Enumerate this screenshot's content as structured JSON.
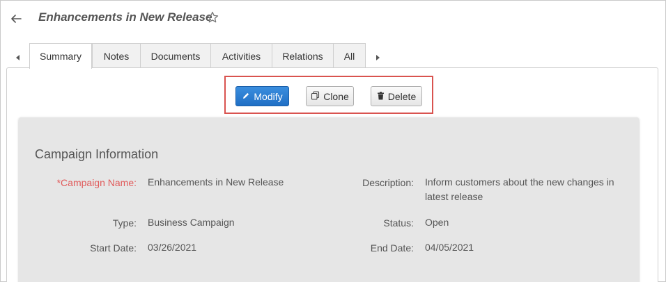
{
  "header": {
    "title": "Enhancements in New Release"
  },
  "tabs": [
    {
      "label": "Summary",
      "active": true
    },
    {
      "label": "Notes",
      "active": false
    },
    {
      "label": "Documents",
      "active": false
    },
    {
      "label": "Activities",
      "active": false
    },
    {
      "label": "Relations",
      "active": false
    },
    {
      "label": "All",
      "active": false
    }
  ],
  "toolbar": {
    "modify_label": "Modify",
    "clone_label": "Clone",
    "delete_label": "Delete"
  },
  "section": {
    "title": "Campaign Information",
    "fields": {
      "campaign_name": {
        "label": "*Campaign Name:",
        "value": "Enhancements in New Release",
        "required": true
      },
      "description": {
        "label": "Description:",
        "value": "Inform customers about the new changes in latest release"
      },
      "type": {
        "label": "Type:",
        "value": "Business Campaign"
      },
      "status": {
        "label": "Status:",
        "value": "Open"
      },
      "start_date": {
        "label": "Start Date:",
        "value": "03/26/2021"
      },
      "end_date": {
        "label": "End Date:",
        "value": "04/05/2021"
      }
    }
  },
  "colors": {
    "primary_button": "#2a7fd4",
    "highlight_border": "#d9534f",
    "required_label": "#e05a5a",
    "card_background": "#e6e6e6"
  },
  "icons": {
    "back": "arrow-left-icon",
    "favorite": "star-outline-icon",
    "modify": "pencil-icon",
    "clone": "copy-icon",
    "delete": "trash-icon",
    "tab_scroll_left": "triangle-left-icon",
    "tab_scroll_right": "triangle-right-icon"
  }
}
